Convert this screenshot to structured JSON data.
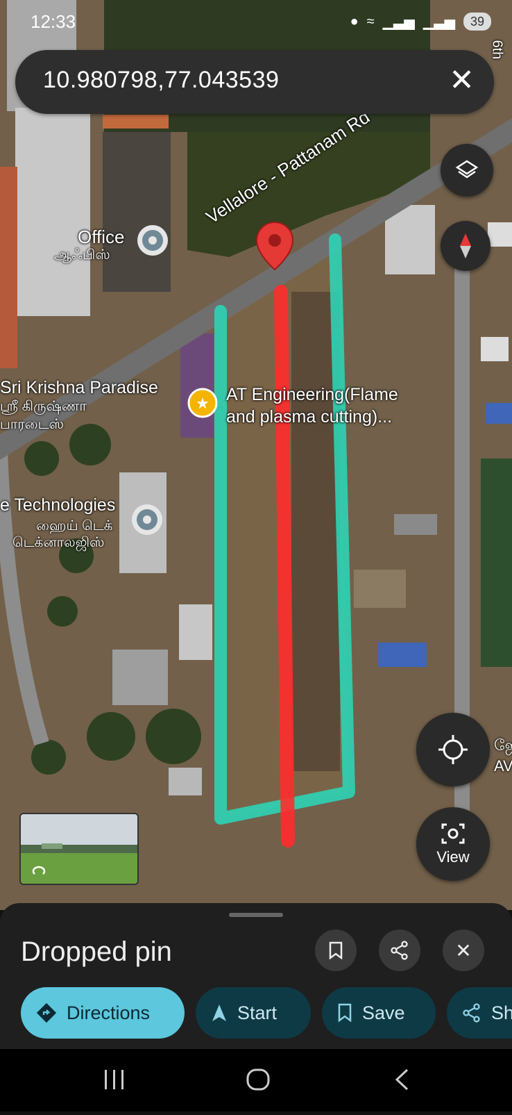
{
  "status_bar": {
    "time": "12:33",
    "battery": "39"
  },
  "search": {
    "query": "10.980798,77.043539"
  },
  "map": {
    "road_label": "Vellalore - Pattanam Rd",
    "road_label_right": "6th",
    "places": [
      {
        "name": "Office",
        "tamil": "ஆஃபிஸ்"
      },
      {
        "name": "Sri Krishna Paradise",
        "tamil_line1": "ஸ்ரீ கிருஷ்ணா",
        "tamil_line2": "பாரடைஸ்"
      },
      {
        "name_line1": "AT Engineering(Flame",
        "name_line2": "and plasma cutting)..."
      },
      {
        "name": "e Technologies",
        "tamil_line1": "ஹைய் டெக்",
        "tamil_line2": "டெக்னாலஜிஸ்"
      }
    ],
    "edge_label": {
      "line1": "ஜே",
      "line2": "AV"
    },
    "view_button": "View"
  },
  "bottom_sheet": {
    "title": "Dropped pin",
    "actions": [
      "Directions",
      "Start",
      "Save",
      "Sh"
    ]
  },
  "colors": {
    "boundary": "#2ed3b5",
    "centerline": "#ff2d2d",
    "directions_bg": "#5cc7dd"
  }
}
